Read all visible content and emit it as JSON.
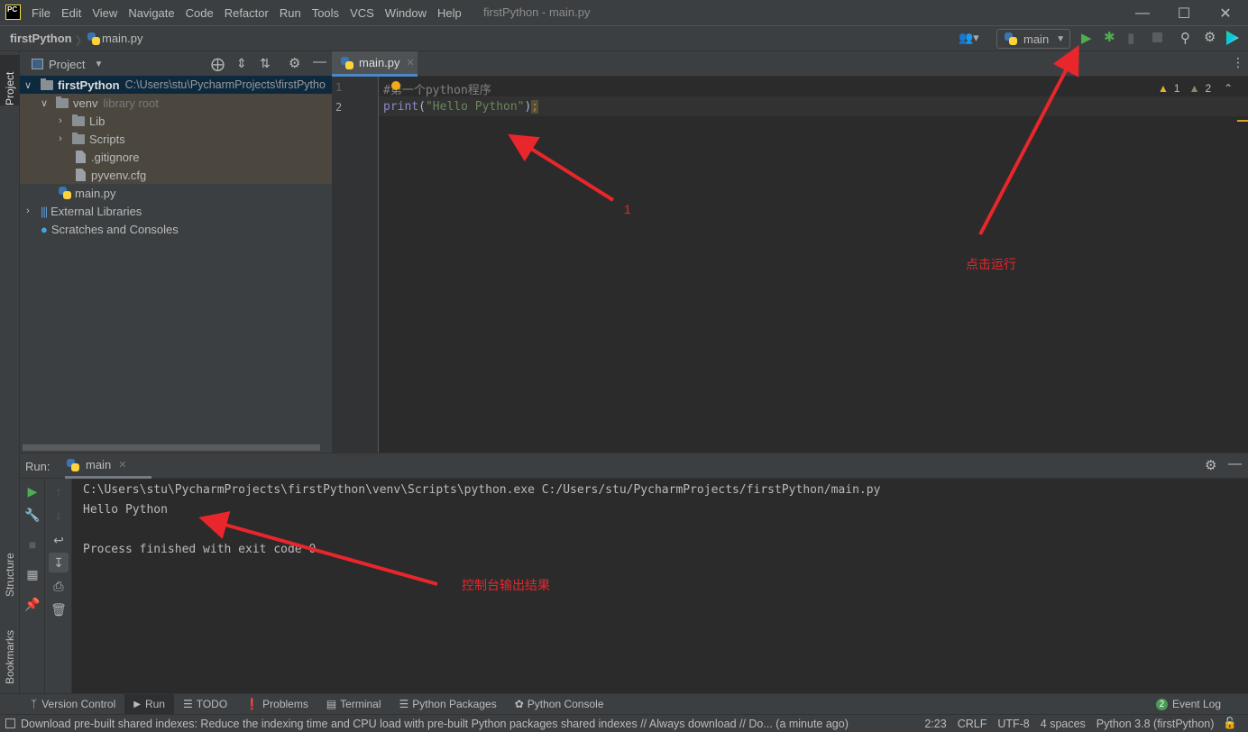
{
  "titlebar": {
    "logo": "PC",
    "menu": [
      "File",
      "Edit",
      "View",
      "Navigate",
      "Code",
      "Refactor",
      "Run",
      "Tools",
      "VCS",
      "Window",
      "Help"
    ],
    "window_title": "firstPython - main.py"
  },
  "navbar": {
    "project": "firstPython",
    "file": "main.py",
    "run_config": "main"
  },
  "left_strip": {
    "project_tab": "Project",
    "structure_tab": "Structure",
    "bookmarks_tab": "Bookmarks"
  },
  "project_panel": {
    "title": "Project",
    "tree": [
      {
        "label": "firstPython",
        "extra": "C:\\Users\\stu\\PycharmProjects\\firstPytho"
      },
      {
        "label": "venv",
        "extra": "library root"
      },
      {
        "label": "Lib"
      },
      {
        "label": "Scripts"
      },
      {
        "label": ".gitignore"
      },
      {
        "label": "pyvenv.cfg"
      },
      {
        "label": "main.py"
      },
      {
        "label": "External Libraries"
      },
      {
        "label": "Scratches and Consoles"
      }
    ]
  },
  "editor": {
    "tab": "main.py",
    "lines": [
      {
        "num": "1",
        "comment": "#第一个python程序"
      },
      {
        "num": "2",
        "fn": "print",
        "open": "(",
        "str": "\"Hello Python\"",
        "close": ")",
        "semi": ";"
      }
    ],
    "warnings": {
      "weak": "1",
      "other": "2"
    }
  },
  "run_panel": {
    "label": "Run:",
    "tab": "main",
    "console": [
      "C:\\Users\\stu\\PycharmProjects\\firstPython\\venv\\Scripts\\python.exe C:/Users/stu/PycharmProjects/firstPython/main.py",
      "Hello Python",
      "",
      "Process finished with exit code 0"
    ]
  },
  "annotations": {
    "a1": "1",
    "a2": "点击运行",
    "a3": "控制台输出结果",
    "color": "#e8262c"
  },
  "tool_windows": [
    "Version Control",
    "Run",
    "TODO",
    "Problems",
    "Terminal",
    "Python Packages",
    "Python Console"
  ],
  "event_log": {
    "count": "2",
    "label": "Event Log"
  },
  "status": {
    "message": "Download pre-built shared indexes: Reduce the indexing time and CPU load with pre-built Python packages shared indexes // Always download // Do... (a minute ago)",
    "position": "2:23",
    "line_sep": "CRLF",
    "encoding": "UTF-8",
    "indent": "4 spaces",
    "interpreter": "Python 3.8 (firstPython)"
  }
}
